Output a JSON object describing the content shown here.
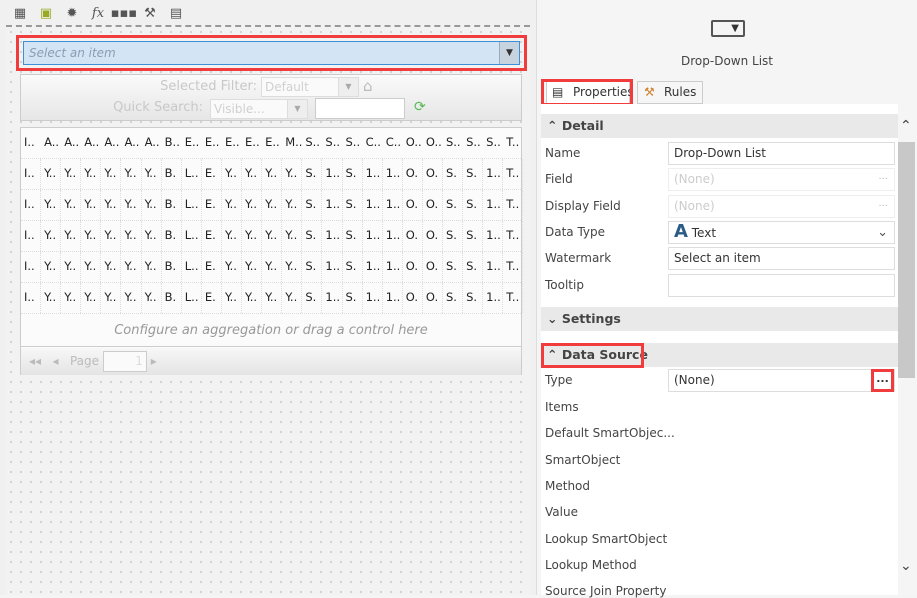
{
  "toolbar": {
    "icons": [
      "table-icon",
      "form-edit-icon",
      "gear-icon",
      "fx-icon",
      "ellipsis-icon",
      "tools-icon",
      "properties-icon"
    ],
    "fx_label": "fx"
  },
  "canvas": {
    "dropdown": {
      "placeholder": "Select an item"
    },
    "filters": {
      "selected_filter_label": "Selected Filter:",
      "selected_filter_value": "Default",
      "quick_search_label": "Quick Search:",
      "quick_search_value": "Visible..."
    },
    "grid": {
      "headers": [
        "I..",
        "A..",
        "A..",
        "A..",
        "A..",
        "A..",
        "A..",
        "B..",
        "E..",
        "E..",
        "E..",
        "E..",
        "E..",
        "M..",
        "S..",
        "S..",
        "S..",
        "C..",
        "C..",
        "O..",
        "O..",
        "S..",
        "S..",
        "S..",
        "T.."
      ],
      "rows": [
        [
          "I..",
          "Y..",
          "Y..",
          "Y..",
          "Y..",
          "Y..",
          "Y..",
          "B.",
          "L..",
          "E.",
          "Y..",
          "Y..",
          "Y..",
          "Y..",
          "S.",
          "1..",
          "S.",
          "1..",
          "1..",
          "O.",
          "O.",
          "S.",
          "S.",
          "1..",
          "T.."
        ],
        [
          "I..",
          "Y..",
          "Y..",
          "Y..",
          "Y..",
          "Y..",
          "Y..",
          "B.",
          "L..",
          "E.",
          "Y..",
          "Y..",
          "Y..",
          "Y..",
          "S.",
          "1..",
          "S.",
          "1..",
          "1..",
          "O.",
          "O.",
          "S.",
          "S.",
          "1..",
          "T.."
        ],
        [
          "I..",
          "Y..",
          "Y..",
          "Y..",
          "Y..",
          "Y..",
          "Y..",
          "B.",
          "L..",
          "E.",
          "Y..",
          "Y..",
          "Y..",
          "Y..",
          "S.",
          "1..",
          "S.",
          "1..",
          "1..",
          "O.",
          "O.",
          "S.",
          "S.",
          "1..",
          "T.."
        ],
        [
          "I..",
          "Y..",
          "Y..",
          "Y..",
          "Y..",
          "Y..",
          "Y..",
          "B.",
          "L..",
          "E.",
          "Y..",
          "Y..",
          "Y..",
          "Y..",
          "S.",
          "1..",
          "S.",
          "1..",
          "1..",
          "O.",
          "O.",
          "S.",
          "S.",
          "1..",
          "T.."
        ],
        [
          "I..",
          "Y..",
          "Y..",
          "Y..",
          "Y..",
          "Y..",
          "Y..",
          "B.",
          "L..",
          "E.",
          "Y..",
          "Y..",
          "Y..",
          "Y..",
          "S.",
          "1..",
          "S.",
          "1..",
          "1..",
          "O.",
          "O.",
          "S.",
          "S.",
          "1..",
          "T.."
        ]
      ],
      "aggregation_hint": "Configure an aggregation or drag a control here",
      "pager": {
        "label": "Page",
        "value": "1"
      }
    }
  },
  "panel": {
    "control_title": "Drop-Down List",
    "tabs": [
      {
        "label": "Properties",
        "active": true
      },
      {
        "label": "Rules",
        "active": false
      }
    ],
    "detail": {
      "title": "Detail",
      "fields": [
        {
          "label": "Name",
          "value": "Drop-Down List"
        },
        {
          "label": "Field",
          "value": "(None)",
          "disabled": true
        },
        {
          "label": "Display Field",
          "value": "(None)",
          "disabled": true
        },
        {
          "label": "Data Type",
          "value": "Text"
        },
        {
          "label": "Watermark",
          "value": "Select an item"
        },
        {
          "label": "Tooltip",
          "value": ""
        }
      ]
    },
    "settings": {
      "title": "Settings"
    },
    "data_source": {
      "title": "Data Source",
      "type_label": "Type",
      "type_value": "(None)",
      "type_button": "...",
      "fields": [
        "Items",
        "Default SmartObjec...",
        "SmartObject",
        "Method",
        "Value",
        "Lookup SmartObject",
        "Lookup Method",
        "Source Join Property"
      ]
    }
  },
  "colors": {
    "highlight": "#f03c3c",
    "dropdown_bg": "#d3e4f4",
    "data_type_icon": "#2b5c85"
  }
}
